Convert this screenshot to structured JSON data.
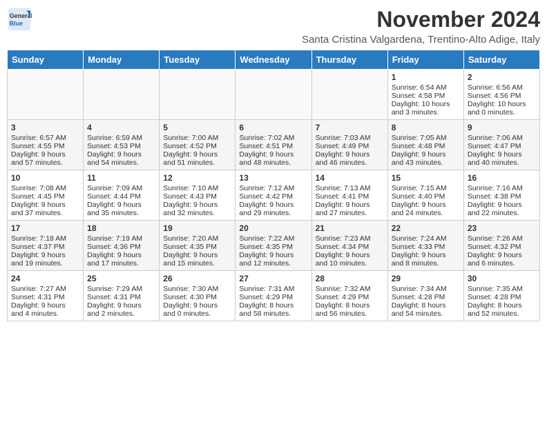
{
  "logo": {
    "general": "General",
    "blue": "Blue"
  },
  "title": "November 2024",
  "subtitle": "Santa Cristina Valgardena, Trentino-Alto Adige, Italy",
  "weekdays": [
    "Sunday",
    "Monday",
    "Tuesday",
    "Wednesday",
    "Thursday",
    "Friday",
    "Saturday"
  ],
  "weeks": [
    [
      {
        "day": "",
        "info": ""
      },
      {
        "day": "",
        "info": ""
      },
      {
        "day": "",
        "info": ""
      },
      {
        "day": "",
        "info": ""
      },
      {
        "day": "",
        "info": ""
      },
      {
        "day": "1",
        "info": "Sunrise: 6:54 AM\nSunset: 4:58 PM\nDaylight: 10 hours\nand 3 minutes."
      },
      {
        "day": "2",
        "info": "Sunrise: 6:56 AM\nSunset: 4:56 PM\nDaylight: 10 hours\nand 0 minutes."
      }
    ],
    [
      {
        "day": "3",
        "info": "Sunrise: 6:57 AM\nSunset: 4:55 PM\nDaylight: 9 hours\nand 57 minutes."
      },
      {
        "day": "4",
        "info": "Sunrise: 6:59 AM\nSunset: 4:53 PM\nDaylight: 9 hours\nand 54 minutes."
      },
      {
        "day": "5",
        "info": "Sunrise: 7:00 AM\nSunset: 4:52 PM\nDaylight: 9 hours\nand 51 minutes."
      },
      {
        "day": "6",
        "info": "Sunrise: 7:02 AM\nSunset: 4:51 PM\nDaylight: 9 hours\nand 48 minutes."
      },
      {
        "day": "7",
        "info": "Sunrise: 7:03 AM\nSunset: 4:49 PM\nDaylight: 9 hours\nand 46 minutes."
      },
      {
        "day": "8",
        "info": "Sunrise: 7:05 AM\nSunset: 4:48 PM\nDaylight: 9 hours\nand 43 minutes."
      },
      {
        "day": "9",
        "info": "Sunrise: 7:06 AM\nSunset: 4:47 PM\nDaylight: 9 hours\nand 40 minutes."
      }
    ],
    [
      {
        "day": "10",
        "info": "Sunrise: 7:08 AM\nSunset: 4:45 PM\nDaylight: 9 hours\nand 37 minutes."
      },
      {
        "day": "11",
        "info": "Sunrise: 7:09 AM\nSunset: 4:44 PM\nDaylight: 9 hours\nand 35 minutes."
      },
      {
        "day": "12",
        "info": "Sunrise: 7:10 AM\nSunset: 4:43 PM\nDaylight: 9 hours\nand 32 minutes."
      },
      {
        "day": "13",
        "info": "Sunrise: 7:12 AM\nSunset: 4:42 PM\nDaylight: 9 hours\nand 29 minutes."
      },
      {
        "day": "14",
        "info": "Sunrise: 7:13 AM\nSunset: 4:41 PM\nDaylight: 9 hours\nand 27 minutes."
      },
      {
        "day": "15",
        "info": "Sunrise: 7:15 AM\nSunset: 4:40 PM\nDaylight: 9 hours\nand 24 minutes."
      },
      {
        "day": "16",
        "info": "Sunrise: 7:16 AM\nSunset: 4:38 PM\nDaylight: 9 hours\nand 22 minutes."
      }
    ],
    [
      {
        "day": "17",
        "info": "Sunrise: 7:18 AM\nSunset: 4:37 PM\nDaylight: 9 hours\nand 19 minutes."
      },
      {
        "day": "18",
        "info": "Sunrise: 7:19 AM\nSunset: 4:36 PM\nDaylight: 9 hours\nand 17 minutes."
      },
      {
        "day": "19",
        "info": "Sunrise: 7:20 AM\nSunset: 4:35 PM\nDaylight: 9 hours\nand 15 minutes."
      },
      {
        "day": "20",
        "info": "Sunrise: 7:22 AM\nSunset: 4:35 PM\nDaylight: 9 hours\nand 12 minutes."
      },
      {
        "day": "21",
        "info": "Sunrise: 7:23 AM\nSunset: 4:34 PM\nDaylight: 9 hours\nand 10 minutes."
      },
      {
        "day": "22",
        "info": "Sunrise: 7:24 AM\nSunset: 4:33 PM\nDaylight: 9 hours\nand 8 minutes."
      },
      {
        "day": "23",
        "info": "Sunrise: 7:26 AM\nSunset: 4:32 PM\nDaylight: 9 hours\nand 6 minutes."
      }
    ],
    [
      {
        "day": "24",
        "info": "Sunrise: 7:27 AM\nSunset: 4:31 PM\nDaylight: 9 hours\nand 4 minutes."
      },
      {
        "day": "25",
        "info": "Sunrise: 7:29 AM\nSunset: 4:31 PM\nDaylight: 9 hours\nand 2 minutes."
      },
      {
        "day": "26",
        "info": "Sunrise: 7:30 AM\nSunset: 4:30 PM\nDaylight: 9 hours\nand 0 minutes."
      },
      {
        "day": "27",
        "info": "Sunrise: 7:31 AM\nSunset: 4:29 PM\nDaylight: 8 hours\nand 58 minutes."
      },
      {
        "day": "28",
        "info": "Sunrise: 7:32 AM\nSunset: 4:29 PM\nDaylight: 8 hours\nand 56 minutes."
      },
      {
        "day": "29",
        "info": "Sunrise: 7:34 AM\nSunset: 4:28 PM\nDaylight: 8 hours\nand 54 minutes."
      },
      {
        "day": "30",
        "info": "Sunrise: 7:35 AM\nSunset: 4:28 PM\nDaylight: 8 hours\nand 52 minutes."
      }
    ]
  ]
}
